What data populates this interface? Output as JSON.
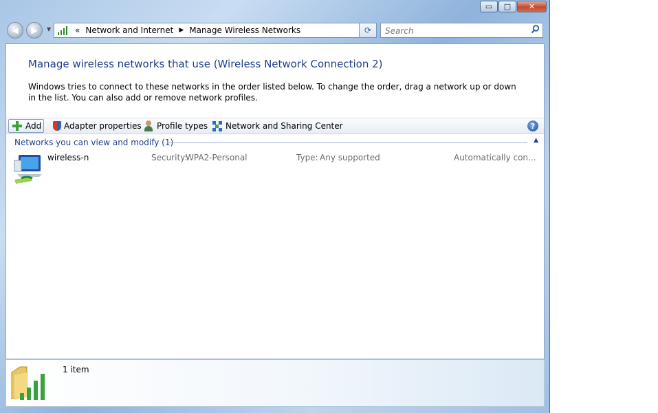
{
  "window": {
    "minimize_glyph": "▭",
    "maximize_glyph": "□",
    "close_glyph": "✕"
  },
  "nav": {
    "back_glyph": "◀",
    "forward_glyph": "▶",
    "breadcrumb_overflow": "«",
    "breadcrumbs": [
      "Network and Internet",
      "Manage Wireless Networks"
    ],
    "separator_glyph": "▶",
    "dropdown_glyph": "▼",
    "refresh_glyph": "⟳"
  },
  "search": {
    "placeholder": "Search",
    "icon": "search-icon"
  },
  "page": {
    "heading": "Manage wireless networks that use (Wireless Network Connection 2)",
    "description": "Windows tries to connect to these networks in the order listed below. To change the order, drag a network up or down in the list. You can also add or remove network profiles."
  },
  "toolbar": {
    "add_label": "Add",
    "adapter_label": "Adapter properties",
    "profile_types_label": "Profile types",
    "network_center_label": "Network and Sharing Center",
    "help_glyph": "?"
  },
  "group": {
    "title": "Networks you can view and modify (1)",
    "collapse_glyph": "▲"
  },
  "networks": [
    {
      "name": "wireless-n",
      "security_label": "Security:",
      "security_value": "WPA2-Personal",
      "type_label": "Type:",
      "type_value": "Any supported",
      "mode": "Automatically con..."
    }
  ],
  "details": {
    "count_text": "1 item"
  },
  "colors": {
    "heading": "#1e3f8c",
    "accent_green": "#3da23d",
    "frame": "#a9c6e6"
  }
}
